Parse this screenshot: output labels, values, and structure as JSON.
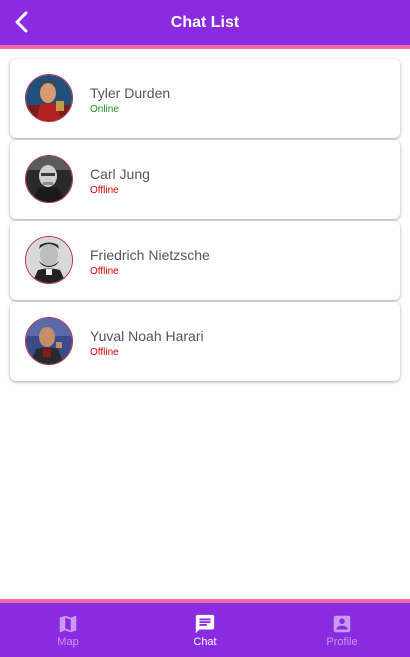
{
  "header": {
    "title": "Chat List",
    "back_icon": "chevron-left-icon"
  },
  "colors": {
    "primary": "#8a2be2",
    "accent": "#f06aa0",
    "online": "#1e8a1e",
    "offline": "#d40000"
  },
  "chats": [
    {
      "name": "Tyler Durden",
      "status": "Online"
    },
    {
      "name": "Carl Jung",
      "status": "Offline"
    },
    {
      "name": "Friedrich Nietzsche",
      "status": "Offline"
    },
    {
      "name": "Yuval Noah Harari",
      "status": "Offline"
    }
  ],
  "nav": {
    "items": [
      {
        "label": "Map",
        "icon": "map-icon",
        "active": false
      },
      {
        "label": "Chat",
        "icon": "chat-icon",
        "active": true
      },
      {
        "label": "Profile",
        "icon": "profile-icon",
        "active": false
      }
    ]
  }
}
